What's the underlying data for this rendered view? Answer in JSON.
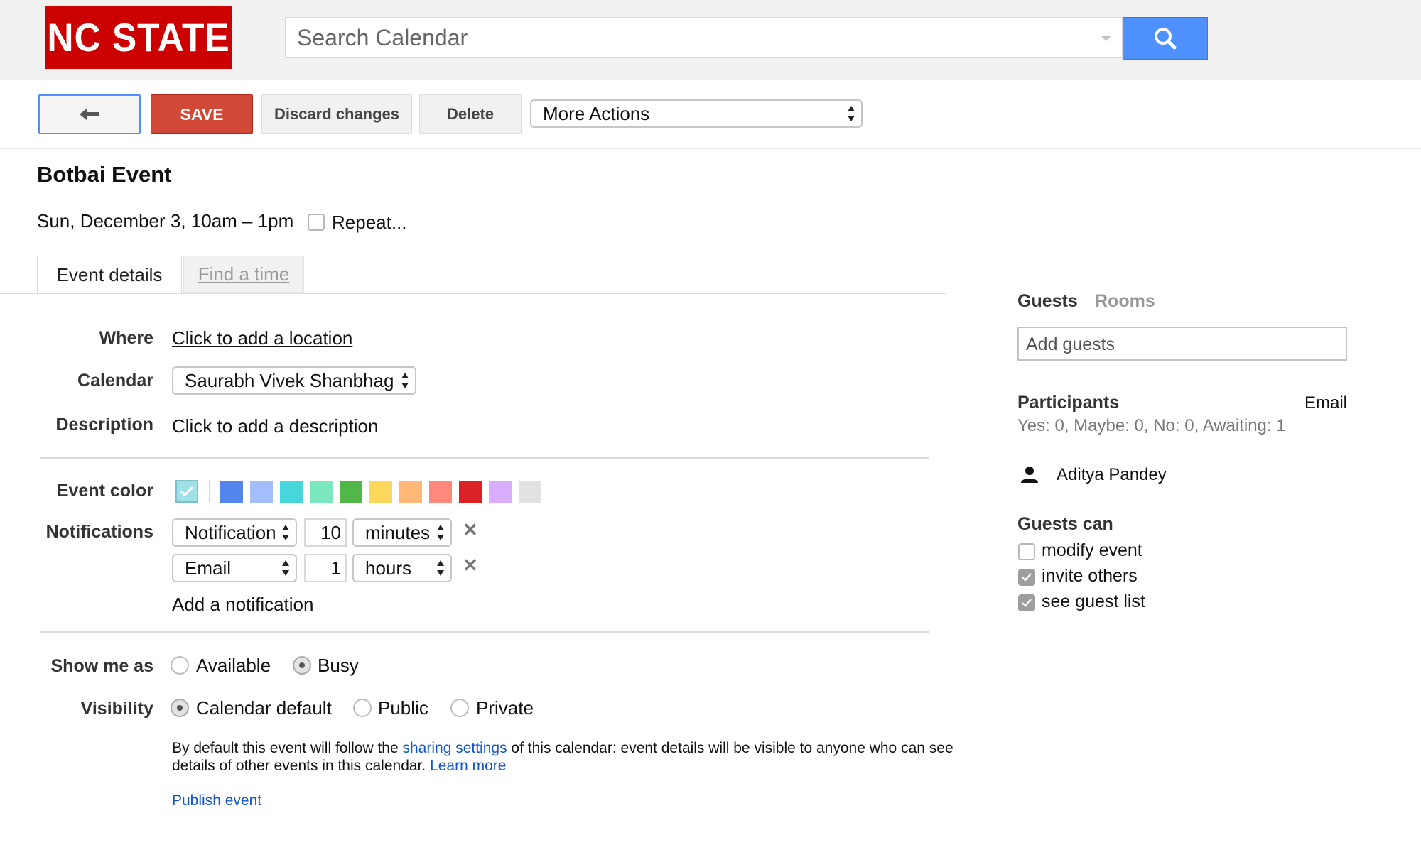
{
  "header": {
    "logo_text": "NC STATE",
    "search_placeholder": "Search Calendar",
    "search_icon": "search-icon"
  },
  "toolbar": {
    "back_icon": "back-arrow-icon",
    "save_label": "SAVE",
    "discard_label": "Discard changes",
    "delete_label": "Delete",
    "more_actions_label": "More Actions"
  },
  "event": {
    "title": "Botbai Event",
    "datetime": "Sun, December 3, 10am – 1pm",
    "repeat_label": "Repeat...",
    "repeat_checked": false
  },
  "tabs": [
    {
      "label": "Event details",
      "active": true
    },
    {
      "label": "Find a time",
      "active": false
    }
  ],
  "form": {
    "where_label": "Where",
    "where_link": "Click to add a location",
    "calendar_label": "Calendar",
    "calendar_value": "Saurabh Vivek Shanbhag",
    "description_label": "Description",
    "description_value": "Click to add a description",
    "event_color_label": "Event color",
    "event_colors": [
      "#5484ed",
      "#a4bdfc",
      "#46d6db",
      "#7ae7bf",
      "#51b749",
      "#fbd75b",
      "#ffb878",
      "#ff887c",
      "#dc2127",
      "#dbadff",
      "#e1e1e1"
    ],
    "selected_color": "#9fe1e7",
    "notifications_label": "Notifications",
    "notifications": [
      {
        "method": "Notification",
        "amount": "10",
        "unit": "minutes"
      },
      {
        "method": "Email",
        "amount": "1",
        "unit": "hours"
      }
    ],
    "add_notification": "Add a notification",
    "show_me_as_label": "Show me as",
    "show_me_as_options": [
      "Available",
      "Busy"
    ],
    "show_me_as_selected": "Busy",
    "visibility_label": "Visibility",
    "visibility_options": [
      "Calendar default",
      "Public",
      "Private"
    ],
    "visibility_selected": "Calendar default",
    "info_text_1": "By default this event will follow the ",
    "info_link_1": "sharing settings",
    "info_text_2": " of this calendar: event details will be visible to anyone who can see details of other events in this calendar.  ",
    "info_link_2": "Learn more",
    "publish_link": "Publish event"
  },
  "sidebar": {
    "guests_tab": "Guests",
    "rooms_tab": "Rooms",
    "add_guests_placeholder": "Add guests",
    "participants_title": "Participants",
    "email_link": "Email",
    "rsvp_summary": "Yes: 0, Maybe: 0, No: 0, Awaiting: 1",
    "participant_icon": "person-icon",
    "participant_name": "Aditya Pandey",
    "guests_can_title": "Guests can",
    "permissions": [
      {
        "label": "modify event",
        "checked": false
      },
      {
        "label": "invite others",
        "checked": true
      },
      {
        "label": "see guest list",
        "checked": true
      }
    ]
  }
}
